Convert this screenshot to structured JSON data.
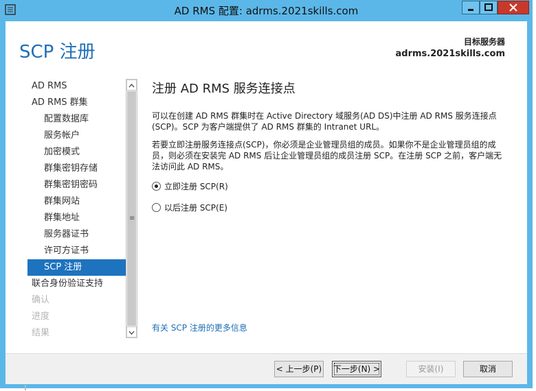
{
  "window": {
    "title": "AD RMS 配置: adrms.2021skills.com",
    "accent_color": "#5bb7e8",
    "icon": "server-config-icon"
  },
  "header": {
    "page_title": "SCP 注册",
    "destination_label": "目标服务器",
    "destination_server": "adrms.2021skills.com"
  },
  "nav": {
    "items": [
      {
        "label": "AD RMS",
        "level": 0,
        "state": "normal"
      },
      {
        "label": "AD RMS 群集",
        "level": 0,
        "state": "normal"
      },
      {
        "label": "配置数据库",
        "level": 1,
        "state": "normal"
      },
      {
        "label": "服务帐户",
        "level": 1,
        "state": "normal"
      },
      {
        "label": "加密模式",
        "level": 1,
        "state": "normal"
      },
      {
        "label": "群集密钥存储",
        "level": 1,
        "state": "normal"
      },
      {
        "label": "群集密钥密码",
        "level": 1,
        "state": "normal"
      },
      {
        "label": "群集网站",
        "level": 1,
        "state": "normal"
      },
      {
        "label": "群集地址",
        "level": 1,
        "state": "normal"
      },
      {
        "label": "服务器证书",
        "level": 1,
        "state": "normal"
      },
      {
        "label": "许可方证书",
        "level": 1,
        "state": "normal"
      },
      {
        "label": "SCP 注册",
        "level": 1,
        "state": "selected"
      },
      {
        "label": "联合身份验证支持",
        "level": 0,
        "state": "normal"
      },
      {
        "label": "确认",
        "level": 0,
        "state": "disabled"
      },
      {
        "label": "进度",
        "level": 0,
        "state": "disabled"
      },
      {
        "label": "结果",
        "level": 0,
        "state": "disabled"
      }
    ]
  },
  "content": {
    "title": "注册 AD RMS 服务连接点",
    "para1": "可以在创建 AD RMS 群集时在 Active Directory 域服务(AD DS)中注册 AD RMS 服务连接点(SCP)。SCP 为客户端提供了 AD RMS 群集的 Intranet URL。",
    "para2": "若要立即注册服务连接点(SCP)，你必须是企业管理员组的成员。如果你不是企业管理员组的成员，则必须在安装完 AD RMS 后让企业管理员组的成员注册 SCP。在注册 SCP 之前，客户端无法访问此 AD RMS。",
    "option_now": "立即注册 SCP(R)",
    "option_later": "以后注册 SCP(E)",
    "selected_option": "option_now",
    "more_info_link": "有关 SCP 注册的更多信息"
  },
  "footer": {
    "prev_label": "< 上一步(P)",
    "next_label": "下一步(N) >",
    "install_label": "安装(I)",
    "cancel_label": "取消"
  }
}
